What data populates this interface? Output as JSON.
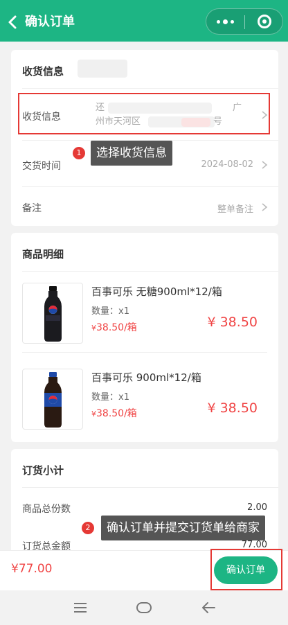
{
  "header": {
    "title": "确认订单",
    "accent_color": "#1db584"
  },
  "delivery_card": {
    "title": "收货信息",
    "address_row": {
      "label": "收货信息",
      "line1_start": "还",
      "line1_end": "广",
      "line2_start": "州市天河区",
      "line2_end": "号"
    },
    "time_row": {
      "label": "交货时间",
      "value": "2024-08-02"
    },
    "remark_row": {
      "label": "备注",
      "value": "整单备注"
    }
  },
  "tips": {
    "tip1_number": "1",
    "tip1_text": "选择收货信息",
    "tip2_number": "2",
    "tip2_text": "确认订单并提交订货单给商家"
  },
  "products_card": {
    "title": "商品明细",
    "items": [
      {
        "name": "百事可乐 无糖900ml*12/箱",
        "qty": "数量：x1",
        "unit_currency": "¥",
        "unit_price": "38.50/箱",
        "total": "¥ 38.50",
        "image_icon": "pepsi-zero-bottle-icon"
      },
      {
        "name": "百事可乐 900ml*12/箱",
        "qty": "数量：x1",
        "unit_currency": "¥",
        "unit_price": "38.50/箱",
        "total": "¥ 38.50",
        "image_icon": "pepsi-bottle-icon"
      }
    ]
  },
  "subtotal_card": {
    "title": "订货小计",
    "rows": [
      {
        "label": "商品总份数",
        "value": "2.00"
      },
      {
        "label": "订货总金额",
        "value": "77.00"
      }
    ]
  },
  "bottom_bar": {
    "total": "¥77.00",
    "confirm_label": "确认订单"
  },
  "system_nav": {
    "icons": [
      "menu-icon",
      "home-icon",
      "back-icon"
    ]
  }
}
